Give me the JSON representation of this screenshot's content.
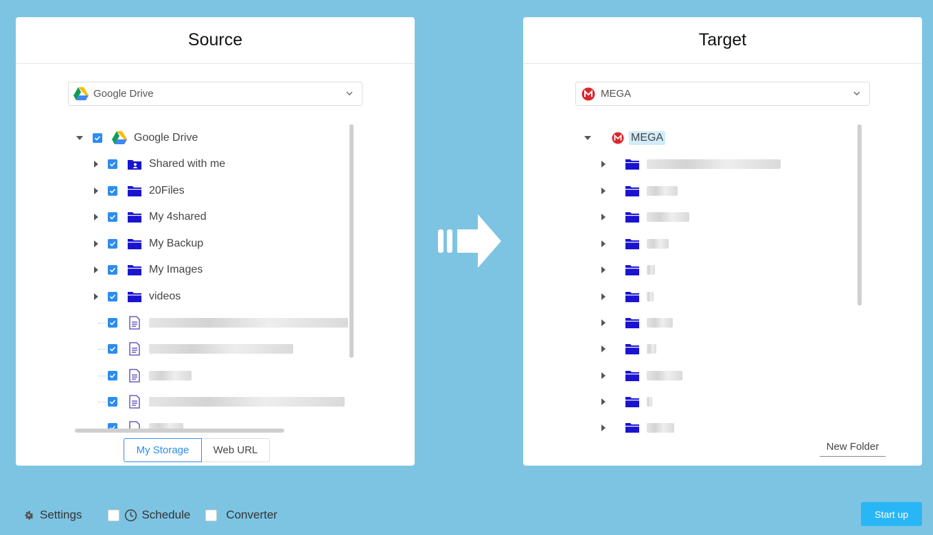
{
  "source": {
    "title": "Source",
    "selector_value": "Google Drive",
    "root_label": "Google Drive",
    "folders": [
      "Shared with me",
      "20Files",
      "My 4shared",
      "My Backup",
      "My Images",
      "videos"
    ],
    "tabs": {
      "my_storage": "My Storage",
      "web_url": "Web URL"
    }
  },
  "target": {
    "title": "Target",
    "selector_value": "MEGA",
    "root_label": "MEGA",
    "new_folder": "New Folder"
  },
  "bottom": {
    "settings": "Settings",
    "schedule": "Schedule",
    "converter": "Converter",
    "start_up": "Start up"
  },
  "colors": {
    "background": "#7dc4e3",
    "accent": "#2d8cf0",
    "folder": "#1a14d0",
    "start_button": "#29b6f6"
  }
}
